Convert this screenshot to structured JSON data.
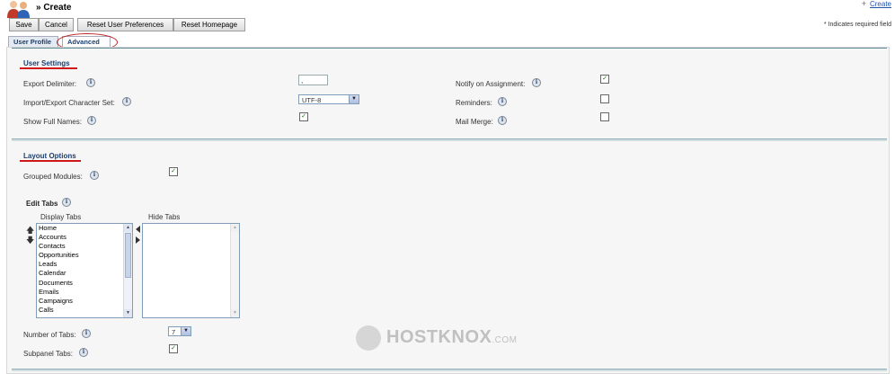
{
  "header": {
    "title": "» Create",
    "create_link": "Create",
    "required_note": "* Indicates required field"
  },
  "toolbar": {
    "save": "Save",
    "cancel": "Cancel",
    "reset_prefs": "Reset User Preferences",
    "reset_home": "Reset Homepage"
  },
  "tabs": {
    "user_profile": "User Profile",
    "advanced": "Advanced"
  },
  "user_settings": {
    "title": "User Settings",
    "export_delimiter_label": "Export Delimiter:",
    "export_delimiter_value": ",",
    "charset_label": "Import/Export Character Set:",
    "charset_value": "UTF-8",
    "show_full_names_label": "Show Full Names:",
    "show_full_names_checked": true,
    "notify_label": "Notify on Assignment:",
    "notify_checked": true,
    "reminders_label": "Reminders:",
    "reminders_checked": false,
    "mail_merge_label": "Mail Merge:",
    "mail_merge_checked": false
  },
  "layout_options": {
    "title": "Layout Options",
    "grouped_modules_label": "Grouped Modules:",
    "grouped_modules_checked": true,
    "edit_tabs_label": "Edit Tabs",
    "display_tabs_label": "Display Tabs",
    "hide_tabs_label": "Hide Tabs",
    "display_tabs": [
      "Home",
      "Accounts",
      "Contacts",
      "Opportunities",
      "Leads",
      "Calendar",
      "Documents",
      "Emails",
      "Campaigns",
      "Calls"
    ],
    "number_of_tabs_label": "Number of Tabs:",
    "number_of_tabs_value": "7",
    "subpanel_tabs_label": "Subpanel Tabs:",
    "subpanel_tabs_checked": true
  },
  "watermark": {
    "brand": "HOSTKNOX",
    "suffix": ".COM"
  },
  "icons": {
    "info": "i",
    "check": "✓",
    "up": "🡅",
    "down": "🡇"
  }
}
